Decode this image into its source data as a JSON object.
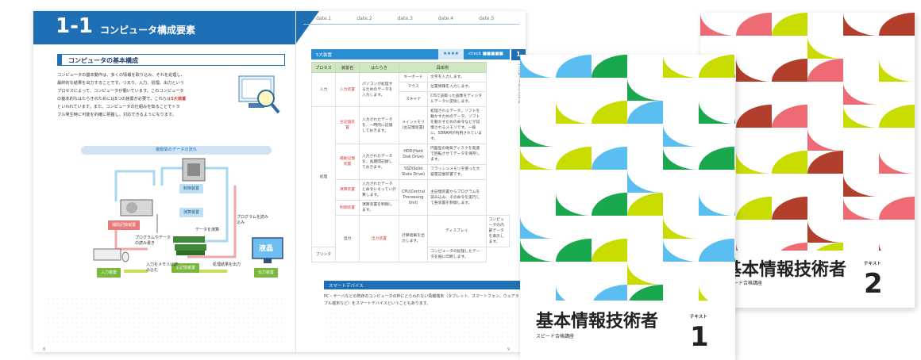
{
  "left_page": {
    "chapter_number": "1-1",
    "chapter_title": "コンピュータ構成要素",
    "section_title": "コンピュータの基本構成",
    "body_lines": [
      "コンピュータの基本動作は、多くの情報を取り込み、それを処理し、",
      "最終的な結果を出力することです。つまり、入力、処理、出力という",
      "プロセスによって、コンピュータが働いています。このコンピュータ",
      "の基本的なはたらきのためには5つの装置が必要で、これらは"
    ],
    "body_highlight": "5大装置",
    "body_tail_lines": [
      "といわれています。また、コンピュータの仕組みを知ることでトラ",
      "ブル発生時に可能を的確に把握し、対応できるようになります。"
    ],
    "figure_title": "複数間のデータの流れ",
    "figure_labels": {
      "control_unit": "制御装置",
      "arith_unit": "演算装置",
      "aux_storage": "補助記憶装置",
      "main_storage": "主記憶装置",
      "input_device": "入力装置",
      "output_device": "出力装置",
      "monitor_text": "液晶",
      "prog_read": "プログラムを読み込み",
      "data_exch": "データを演算",
      "prog_write": "プログラムやデータの読み書き",
      "input_mem": "入力をメモリに読み込む",
      "output_res": "処理結果を出力"
    },
    "page_number": "8"
  },
  "date_labels": [
    "date.1",
    "date.2",
    "date.3",
    "date.4",
    "date.5"
  ],
  "right_page": {
    "keyword_title": "5大装置",
    "stars": "★★★★",
    "check_label": "check ■■■■■",
    "side_tab": "1",
    "side_vertical": "コンピュータシステム",
    "table_headers": [
      "プロセス",
      "装置名",
      "はたらき",
      "具体例"
    ],
    "table_rows": [
      {
        "process": "入力",
        "device": "入力装置",
        "function": "パソコンが処理するためのデータを入力します。",
        "examples": [
          {
            "name": "キーボード",
            "desc": "文字を入力します。"
          },
          {
            "name": "マウス",
            "desc": "位置情報を入力します。"
          },
          {
            "name": "スキャナ",
            "desc": "CISで読取った画像をディジタルデータに変換します。"
          }
        ]
      },
      {
        "process": "処理",
        "device": "主記憶装置",
        "function": "入力されたデータを、一時的に記憶しておきます。",
        "examples": [
          {
            "name": "メインメモリ(主記憶装置)",
            "desc": "処理されるデータ、ソフトを動かすためのデータ、ソフトを動かすための命令などが記憶されるメモリです。一般に、SDRAMが利用されています。"
          }
        ]
      },
      {
        "process": "",
        "device": "補助記憶装置",
        "function": "入力されたデータを、長期間記録しておきます。",
        "examples": [
          {
            "name": "HDD(Hard Disk Drive)",
            "desc": "円盤型の磁気ディスクを高速で回転させてデータを保存します。"
          },
          {
            "name": "SSD(Solid State Drive)",
            "desc": "フラッシュメモリを使った大容量記憶装置です。"
          }
        ]
      },
      {
        "process": "",
        "device": "演算装置",
        "function": "入力されたデータと命令にそってい計算します。",
        "examples": [
          {
            "name": "CPU(Central Processing Unit)",
            "desc": "主記憶装置からプログラムを読み込み、その命令を実行して各装置を制御します。"
          }
        ]
      },
      {
        "process": "",
        "device": "制御装置",
        "function": "演算装置を制御します。",
        "examples": []
      },
      {
        "process": "出力",
        "device": "出力装置",
        "function": "計算結果を出力します。",
        "examples": [
          {
            "name": "ディスプレイ",
            "desc": "コンピュータの内部データを表示します。"
          },
          {
            "name": "プリンタ",
            "desc": "コンピュータの処理したデータを紙に印刷します。"
          }
        ]
      }
    ],
    "smart_title": "スマートデバイス",
    "smart_text": "PC・サーバなどの既存のコンピュータの枠にとらわれない情報端末（タブレット、スマートフォン、ウェアラブル端末など）をスマートデバイスということもあります。",
    "page_number": "9"
  },
  "covers": [
    {
      "title": "基本情報技術者",
      "publisher": "スピード合格講座",
      "text_label": "テキスト",
      "number": "1",
      "colors": [
        "#5bbef0",
        "#1aa84f",
        "#c8dc00"
      ]
    },
    {
      "title": "基本情報技術者",
      "publisher": "スピード合格講座",
      "text_label": "テキスト",
      "number": "2",
      "colors": [
        "#ee6b73",
        "#c8dc00",
        "#b23f2c"
      ]
    }
  ]
}
